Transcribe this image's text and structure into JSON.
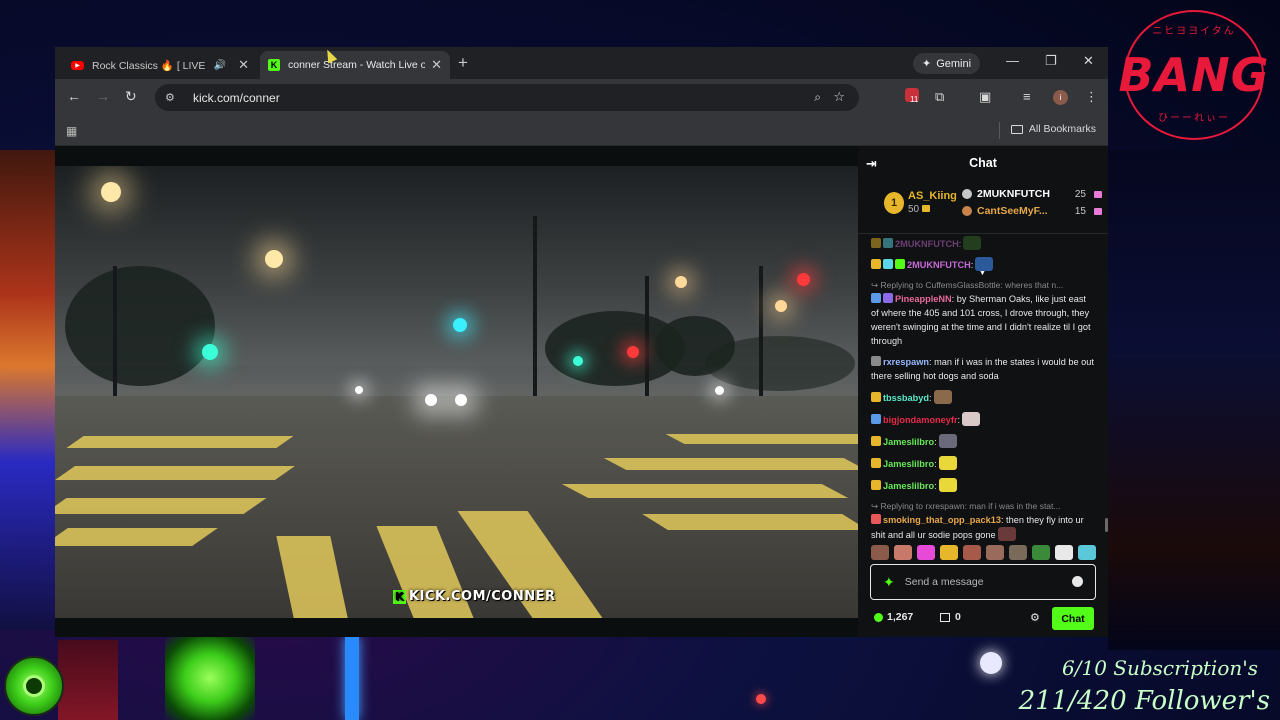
{
  "overlay": {
    "bang_text": "BANG",
    "bang_arc_top": "ニヒヨヨイタん",
    "bang_arc_bottom": "ひーーれぃー",
    "subscription_goal": "6/10 Subscription's",
    "follower_goal": "211/420 Follower's"
  },
  "browser": {
    "tabs": [
      {
        "title": "Rock Classics 🔥 [ LIVE ] Ti",
        "icon": "youtube-icon",
        "audio": true
      },
      {
        "title": "conner Stream - Watch Live on",
        "icon": "kick-icon",
        "active": true
      }
    ],
    "gemini_label": "Gemini",
    "url": "kick.com/conner",
    "extension_badge_count": "11",
    "profile_initial": "i",
    "all_bookmarks_label": "All Bookmarks"
  },
  "video": {
    "watermark": "KICK.COM/CONNER",
    "watermark_k": "K"
  },
  "chat": {
    "title": "Chat",
    "leaderboard": {
      "first": {
        "rank": "1",
        "name": "AS_Kiing",
        "amount": "50"
      },
      "second": {
        "name": "2MUKNFUTCH",
        "amount": "25"
      },
      "third": {
        "name": "CantSeeMyF...",
        "amount": "15"
      }
    },
    "messages": [
      {
        "user": "2MUKNFUTCH",
        "text": ":",
        "color": "#c86ad8",
        "faded": true
      },
      {
        "user": "2MUKNFUTCH",
        "text": ":",
        "color": "#c86ad8"
      },
      {
        "reply": "↪ Replying to CuffemsGlassBottle: wheres that n...",
        "user": "PineappleNN",
        "text": ": by Sherman Oaks, like just east of where the 405 and 101 cross, I drove through, they weren't swinging at the time and I didn't realize til I got through",
        "color": "#e86a9a"
      },
      {
        "user": "rxrespawn",
        "text": ": man if i was in the states i would be out there selling hot dogs and soda",
        "color": "#9ab8ff"
      },
      {
        "user": "tbssbabyd",
        "text": ":",
        "color": "#5ae8c8"
      },
      {
        "user": "bigjondamoneyfr",
        "text": ":",
        "color": "#e82a4a"
      },
      {
        "user": "Jameslilbro",
        "text": ":",
        "color": "#6ae85a"
      },
      {
        "user": "Jameslilbro",
        "text": ":",
        "color": "#6ae85a"
      },
      {
        "user": "Jameslilbro",
        "text": ":",
        "color": "#6ae85a"
      },
      {
        "reply": "↪ Replying to rxrespawn: man if i was in the stat...",
        "user": "smoking_that_opp_pack13",
        "text": ": then they fly into ur shit and all ur sodie pops gone",
        "color": "#e8a84a"
      }
    ],
    "input_placeholder": "Send a message",
    "points": "1,267",
    "gifts": "0",
    "send_label": "Chat"
  }
}
